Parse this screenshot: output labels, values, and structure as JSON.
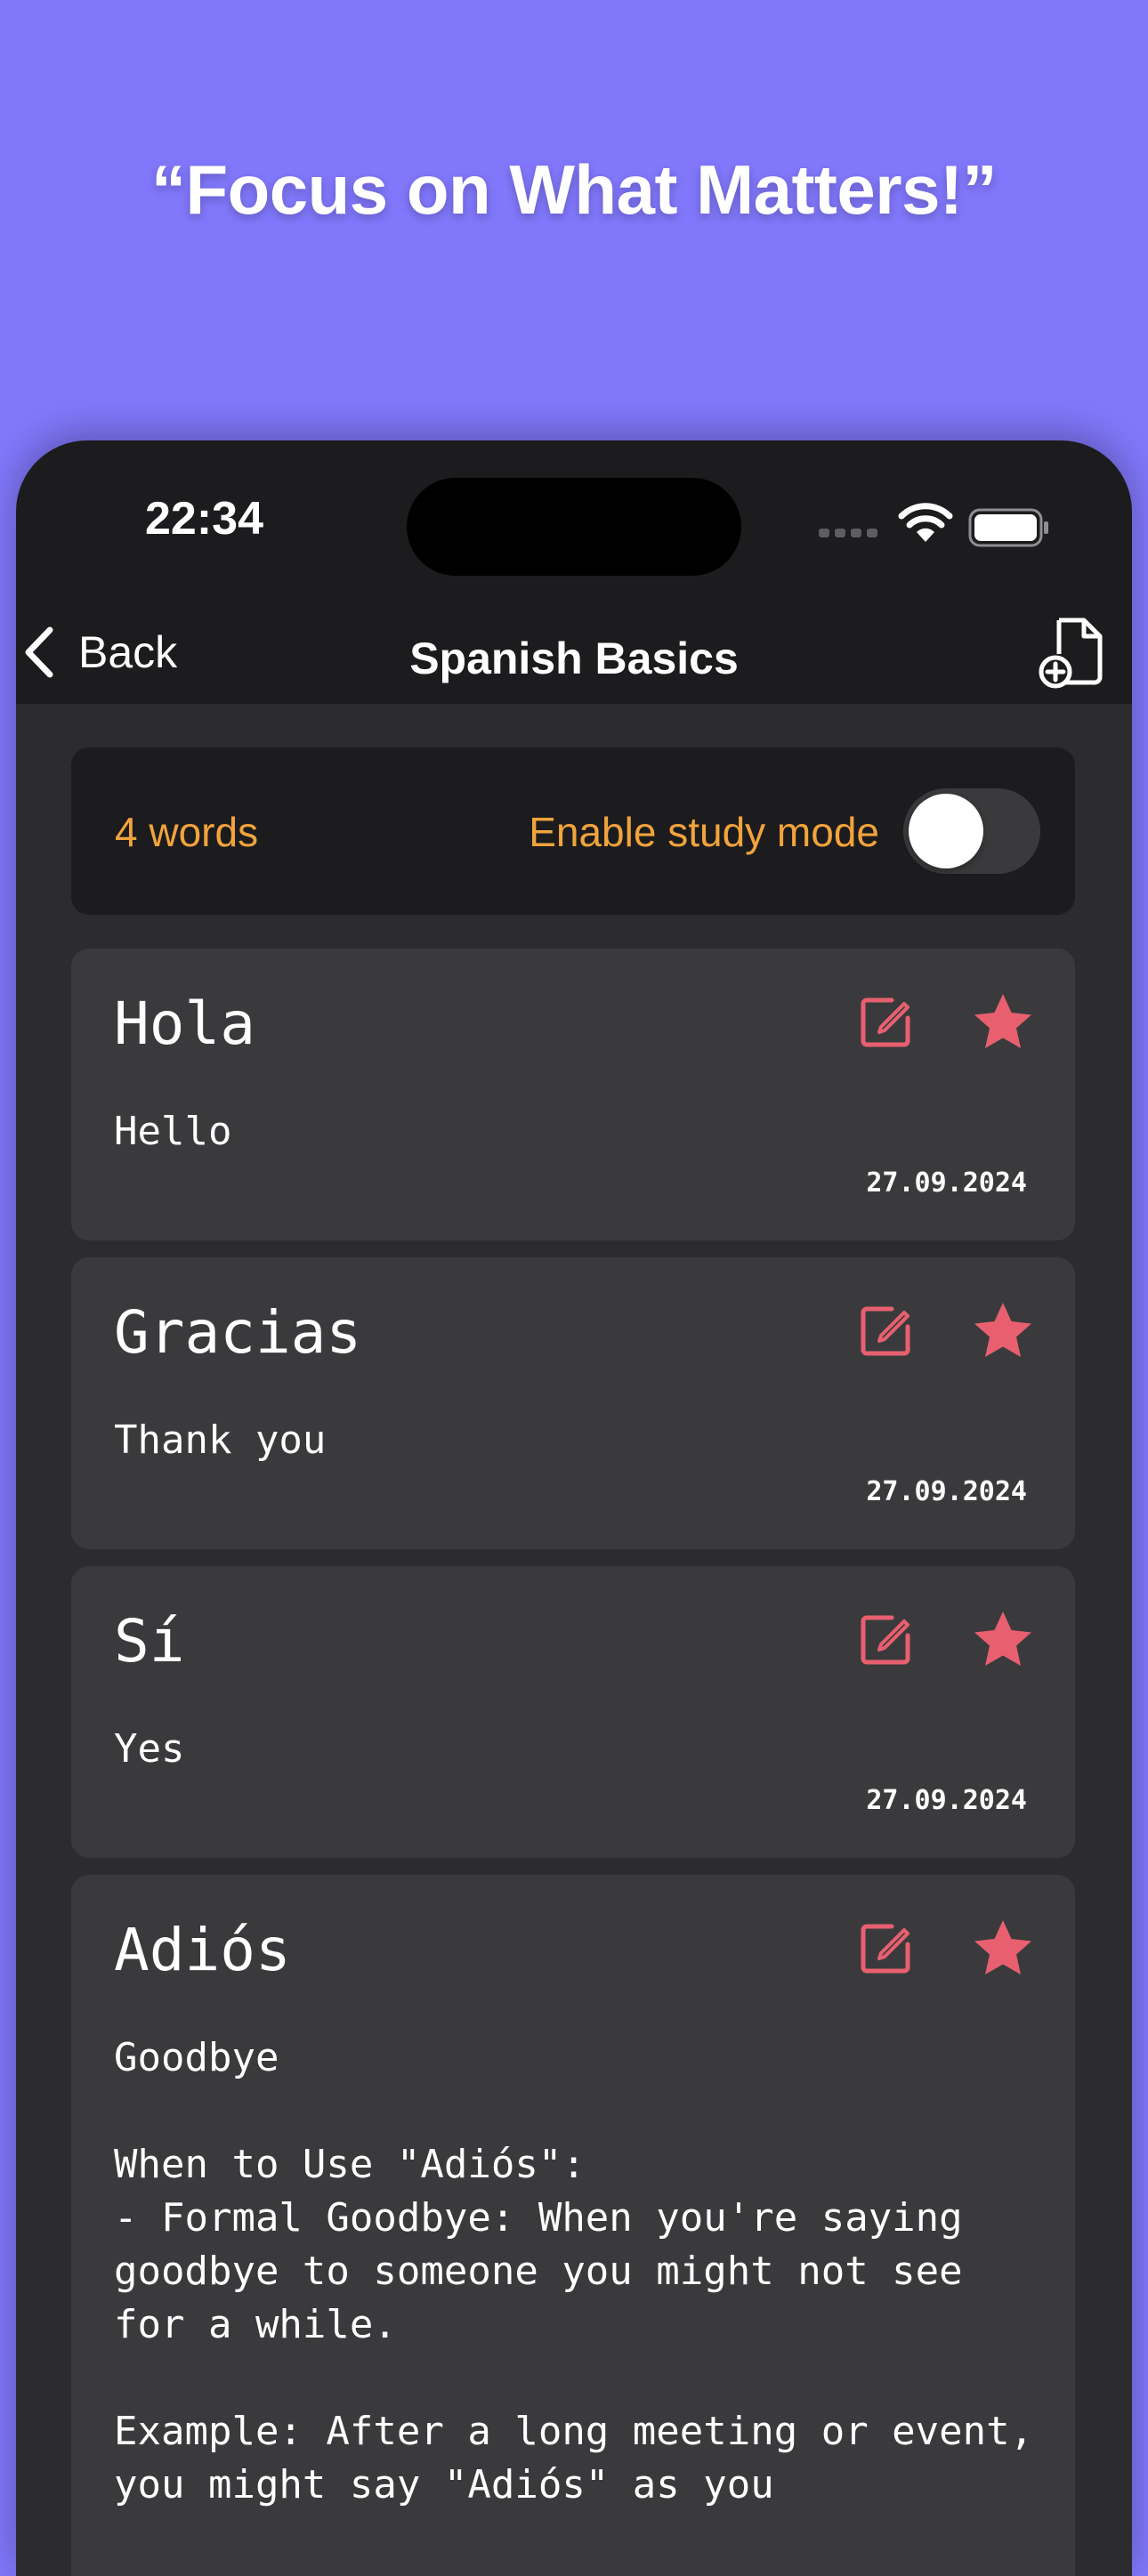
{
  "headline": "“Focus on What Matters!”",
  "status_bar": {
    "time": "22:34"
  },
  "nav": {
    "back_label": "Back",
    "title": "Spanish Basics"
  },
  "summary": {
    "word_count": "4 words",
    "study_mode_label": "Enable study mode",
    "study_mode_enabled": false
  },
  "colors": {
    "accent": "#F2A33C",
    "icon": "#E86070",
    "background": "#8077FA",
    "card": "#3A3A3C"
  },
  "cards": [
    {
      "word": "Hola",
      "translation": "Hello",
      "date": "27.09.2024"
    },
    {
      "word": "Gracias",
      "translation": "Thank you",
      "date": "27.09.2024"
    },
    {
      "word": "Sí",
      "translation": "Yes",
      "date": "27.09.2024"
    },
    {
      "word": "Adiós",
      "translation": "Goodbye\n\nWhen to Use \"Adiós\":\n- Formal Goodbye: When you're saying goodbye to someone you might not see for a while.\n\nExample: After a long meeting or event, you might say \"Adiós\" as you"
    }
  ]
}
